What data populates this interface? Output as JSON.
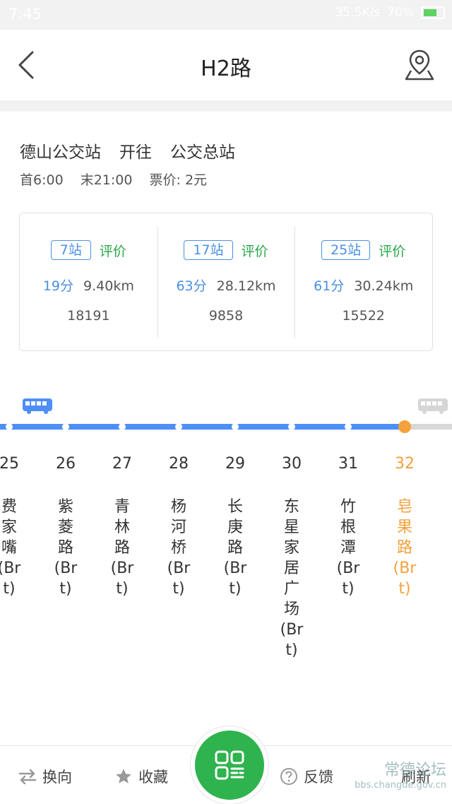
{
  "status_bar": {
    "time": "7:45",
    "net_speed": "35.5K/s",
    "battery": "70%"
  },
  "header": {
    "title": "H2路"
  },
  "route": {
    "from": "德山公交站",
    "direction": "开往",
    "to": "公交总站",
    "first_bus": "首6:00",
    "last_bus": "末21:00",
    "fare": "票价: 2元"
  },
  "summaries": [
    {
      "stops": "7站",
      "rate": "评价",
      "time": "19分",
      "distance": "9.40km",
      "id": "18191"
    },
    {
      "stops": "17站",
      "rate": "评价",
      "time": "63分",
      "distance": "28.12km",
      "id": "9858"
    },
    {
      "stops": "25站",
      "rate": "评价",
      "time": "61分",
      "distance": "30.24km",
      "id": "15522"
    }
  ],
  "stations": [
    {
      "num": "25",
      "name": "费家嘴(Brt)"
    },
    {
      "num": "26",
      "name": "紫菱路(Brt)"
    },
    {
      "num": "27",
      "name": "青林路(Brt)"
    },
    {
      "num": "28",
      "name": "杨河桥(Brt)"
    },
    {
      "num": "29",
      "name": "长庚路(Brt)"
    },
    {
      "num": "30",
      "name": "东星家居广场(Brt)"
    },
    {
      "num": "31",
      "name": "竹根潭(Brt)"
    },
    {
      "num": "32",
      "name": "皂果路(Brt)"
    }
  ],
  "current_station": "32",
  "bottom_bar": {
    "reverse": "换向",
    "favorite": "收藏",
    "feedback": "反馈",
    "refresh": "刷新"
  },
  "watermark": {
    "text": "常德论坛",
    "url": "bbs.changde.gov.cn"
  },
  "colors": {
    "accent_blue": "#4d8ef7",
    "accent_green": "#2fb34e",
    "current_orange": "#f5a13b"
  }
}
